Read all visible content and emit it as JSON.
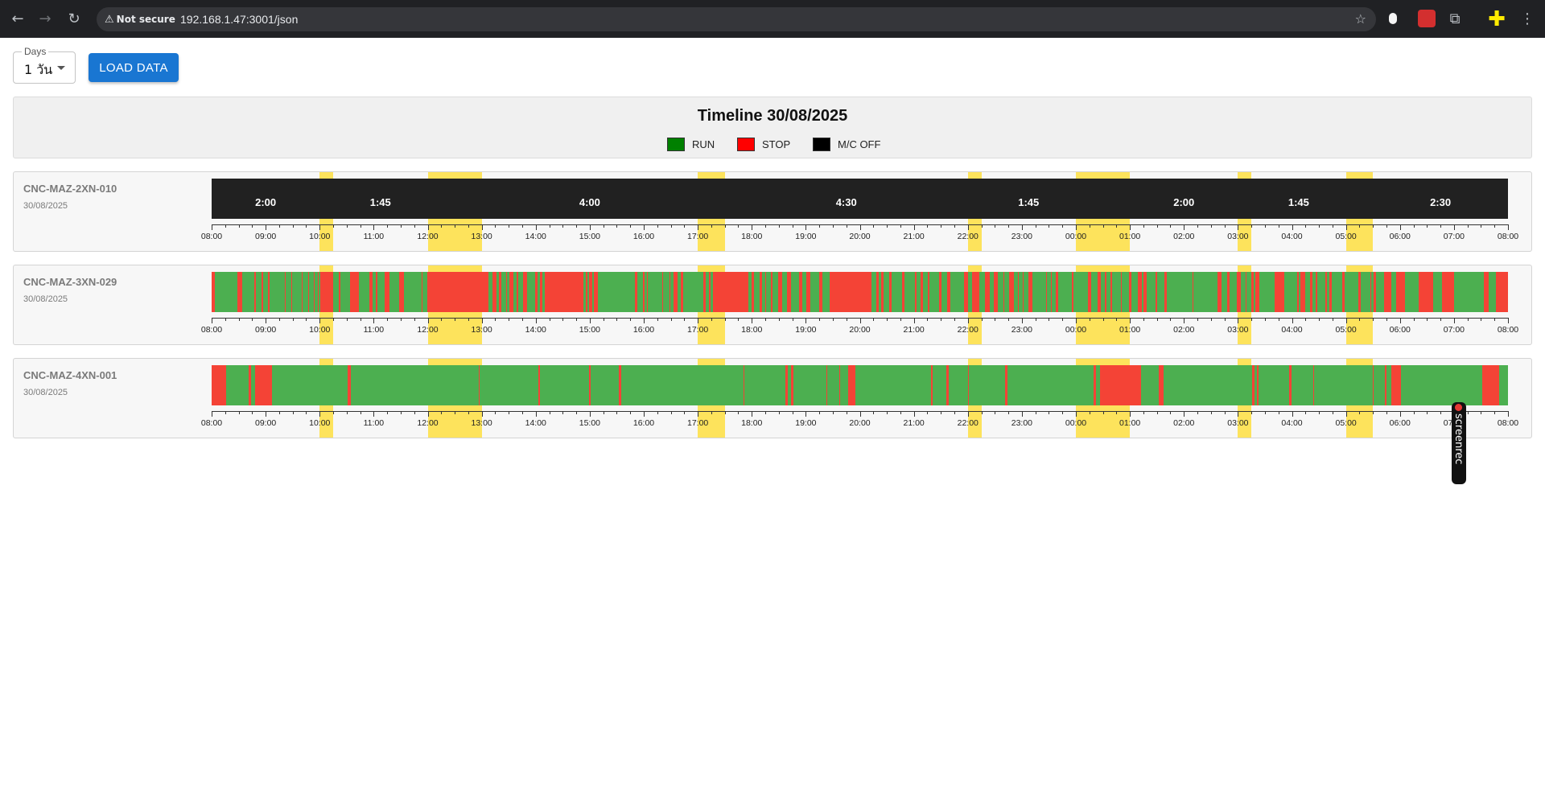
{
  "browser": {
    "not_secure": "Not secure",
    "url": "192.168.1.47:3001/json"
  },
  "controls": {
    "days_label": "Days",
    "days_value": "1 วัน",
    "load_button": "LOAD DATA"
  },
  "header": {
    "title": "Timeline 30/08/2025",
    "legend": [
      {
        "label": "RUN",
        "color": "#008000"
      },
      {
        "label": "STOP",
        "color": "#ff0000"
      },
      {
        "label": "M/C OFF",
        "color": "#000000"
      }
    ]
  },
  "colors": {
    "run": "#4caf50",
    "stop": "#f44336",
    "off": "#212121",
    "highlight": "#fde35c"
  },
  "axis_labels": [
    "08:00",
    "09:00",
    "10:00",
    "11:00",
    "12:00",
    "13:00",
    "14:00",
    "15:00",
    "16:00",
    "17:00",
    "18:00",
    "19:00",
    "20:00",
    "21:00",
    "22:00",
    "23:00",
    "00:00",
    "01:00",
    "02:00",
    "03:00",
    "04:00",
    "05:00",
    "06:00",
    "07:00",
    "08:00"
  ],
  "break_windows_hours": [
    [
      2,
      2.25
    ],
    [
      4,
      5
    ],
    [
      9,
      9.5
    ],
    [
      14,
      14.25
    ],
    [
      16,
      17
    ],
    [
      19,
      19.25
    ],
    [
      21,
      21.5
    ]
  ],
  "machines": [
    {
      "name": "CNC-MAZ-2XN-010",
      "date": "30/08/2025",
      "off_durations": [
        {
          "label": "2:00",
          "at_hour": 1
        },
        {
          "label": "1:45",
          "at_hour": 3.125
        },
        {
          "label": "4:00",
          "at_hour": 7
        },
        {
          "label": "4:30",
          "at_hour": 11.75
        },
        {
          "label": "1:45",
          "at_hour": 15.125
        },
        {
          "label": "2:00",
          "at_hour": 18
        },
        {
          "label": "1:45",
          "at_hour": 20.125
        },
        {
          "label": "2:30",
          "at_hour": 22.75
        }
      ],
      "pattern": "off"
    },
    {
      "name": "CNC-MAZ-3XN-029",
      "date": "30/08/2025",
      "pattern": "mixed"
    },
    {
      "name": "CNC-MAZ-4XN-001",
      "date": "30/08/2025",
      "pattern": "mostly-run"
    }
  ]
}
